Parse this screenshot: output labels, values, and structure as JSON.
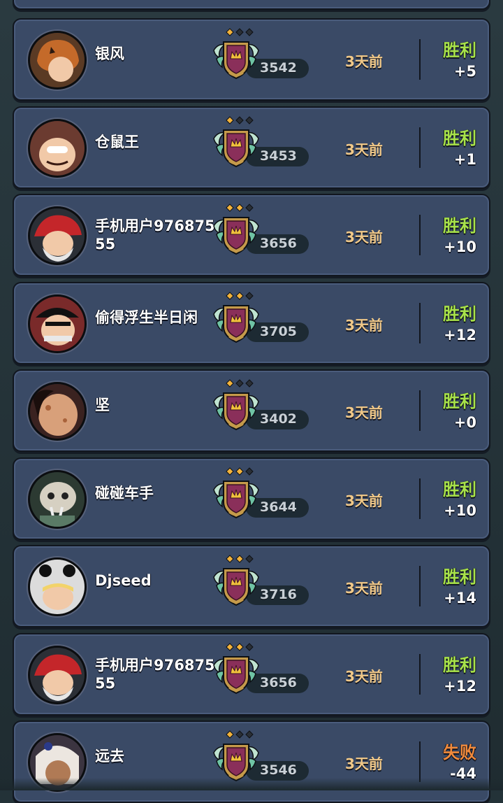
{
  "colors": {
    "win": "#a8e24a",
    "loss": "#f08a3c",
    "card": "#3a4a66",
    "time": "#f0c888"
  },
  "matches": [
    {
      "name": "银风",
      "score": "3542",
      "time": "3天前",
      "result": "胜利",
      "delta": "+5",
      "pips": 1,
      "avatar": "pumpkin-avatar-icon"
    },
    {
      "name": "仓鼠王",
      "score": "3453",
      "time": "3天前",
      "result": "胜利",
      "delta": "+1",
      "pips": 1,
      "avatar": "hamster-hood-avatar-icon"
    },
    {
      "name": "手机用户97687555",
      "score": "3656",
      "time": "3天前",
      "result": "胜利",
      "delta": "+10",
      "pips": 2,
      "avatar": "red-hat-avatar-icon"
    },
    {
      "name": "偷得浮生半日闲",
      "score": "3705",
      "time": "3天前",
      "result": "胜利",
      "delta": "+12",
      "pips": 2,
      "avatar": "bandana-avatar-icon"
    },
    {
      "name": "坚",
      "score": "3402",
      "time": "3天前",
      "result": "胜利",
      "delta": "+0",
      "pips": 1,
      "avatar": "potato-avatar-icon"
    },
    {
      "name": "碰碰车手",
      "score": "3644",
      "time": "3天前",
      "result": "胜利",
      "delta": "+10",
      "pips": 2,
      "avatar": "skull-avatar-icon"
    },
    {
      "name": "Djseed",
      "score": "3716",
      "time": "3天前",
      "result": "胜利",
      "delta": "+14",
      "pips": 2,
      "avatar": "panda-hood-avatar-icon"
    },
    {
      "name": "手机用户97687555",
      "score": "3656",
      "time": "3天前",
      "result": "胜利",
      "delta": "+12",
      "pips": 2,
      "avatar": "red-hat-avatar-icon"
    },
    {
      "name": "远去",
      "score": "3546",
      "time": "3天前",
      "result": "失败",
      "delta": "-44",
      "pips": 1,
      "avatar": "white-hair-avatar-icon"
    }
  ]
}
